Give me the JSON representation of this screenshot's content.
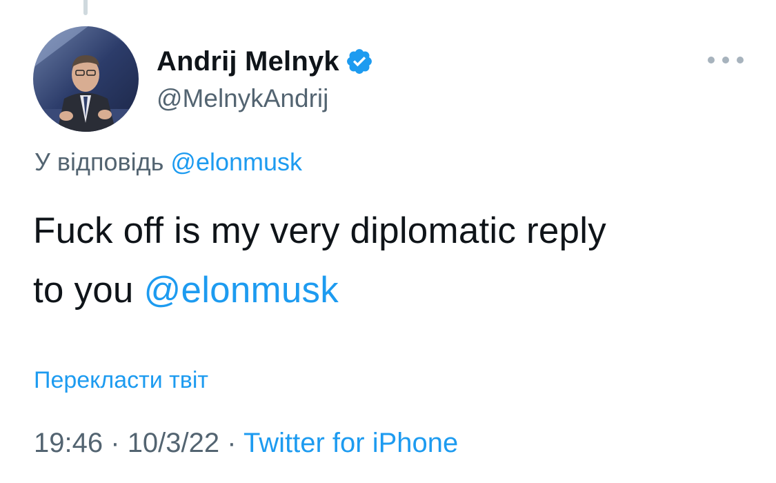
{
  "tweet": {
    "author": {
      "display_name": "Andrij Melnyk",
      "handle": "@MelnykAndrij",
      "verified": true,
      "verified_badge_icon": "verified-badge-icon"
    },
    "reply_to": {
      "prefix": "У відповідь",
      "mention": "@elonmusk"
    },
    "text": {
      "line1": "Fuck off is my very diplomatic reply",
      "line2_plain": "to you",
      "line2_mention": "@elonmusk"
    },
    "translate_label": "Перекласти твіт",
    "meta": {
      "time": "19:46",
      "separator": "·",
      "date": "10/3/22",
      "source": "Twitter for iPhone"
    },
    "more_icon": "more-dots-icon"
  },
  "colors": {
    "link": "#1d9bf0",
    "secondary_text": "#536471",
    "primary_text": "#0f1419",
    "thread_line": "#cfd9de"
  }
}
